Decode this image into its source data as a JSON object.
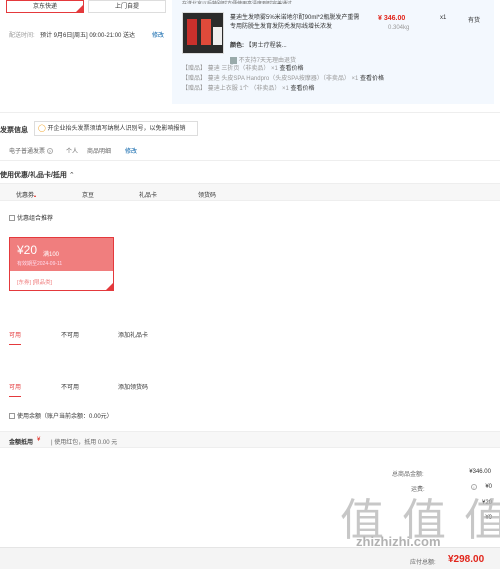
{
  "delivery": {
    "option_express": "京东快递",
    "option_pickup": "上门自提",
    "time_label": "配送时间:",
    "time_value": "预计 9月6日[周五] 09:00-21:00 送达",
    "modify": "修改"
  },
  "product": {
    "top_text": "在送北京以后特别时方便使用高清度到时完美通过",
    "title": "蔓迪生发喷雾5%米诺地尔酊90ml*2瓶脱发产重需专用防脱生发育发防秃发际线增长浓发",
    "price": "¥ 346.00",
    "weight": "0.304kg",
    "qty": "x1",
    "stock": "有货",
    "color_label": "颜色:",
    "color_value": "【男士疗程装...",
    "return_policy": "不支持7天无理由退货",
    "gifts": [
      {
        "tag": "【赠品】",
        "text": "蔓迪 三折页（非卖品） ×1",
        "link": "查看价格"
      },
      {
        "tag": "【赠品】",
        "text": "蔓迪 头皮SPA Handpro（头皮SPA按摩器）（非卖品） ×1",
        "link": "查看价格"
      },
      {
        "tag": "【赠品】",
        "text": "蔓迪上衣服 1个 （非卖品） ×1",
        "link": "查看价格"
      }
    ]
  },
  "invoice": {
    "title": "发票信息",
    "notice": "开企业抬头发票须填写纳税人识别号，以免影响报销",
    "type": "电子普通发票",
    "holder": "个人",
    "content": "商品明细",
    "modify": "修改"
  },
  "coupons": {
    "section_title": "使用优惠/礼品卡/抵用",
    "tabs": [
      "优惠券",
      "京豆",
      "礼品卡",
      "领货码"
    ],
    "combo_label": "优惠组合推荐",
    "coupon": {
      "amount": "¥20",
      "condition": "满100",
      "validity": "有效期至2024-09-11",
      "tags": "[东券] [限品类]"
    },
    "giftcard_tabs": [
      "可用",
      "不可用",
      "添加礼品卡"
    ],
    "code_tabs": [
      "可用",
      "不可用",
      "添加领货码"
    ],
    "balance_label": "使用余额（账户当前余额：0.00元）",
    "deduct_label": "金额抵用",
    "deduct_currency": "¥",
    "deduct_note": "| 使用红包，抵用 0.00 元"
  },
  "summary": {
    "total_label": "总商品金额:",
    "total_value": "¥346.00",
    "shipping_label": "运费:",
    "shipping_value": "¥0",
    "discount_value": "¥20",
    "service_value": "¥0",
    "payable_label": "应付总额:",
    "payable_value": "¥298.00"
  },
  "watermark": {
    "text": "值 值 值",
    "site": "zhizhizhi.com"
  }
}
